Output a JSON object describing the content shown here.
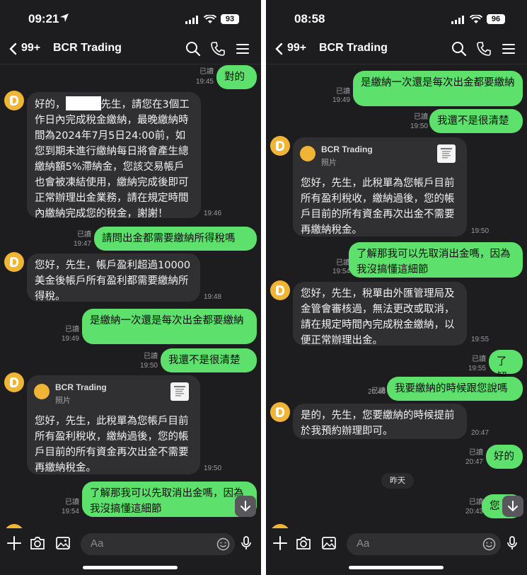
{
  "screens": [
    {
      "status": {
        "time": "09:21",
        "battery": "93"
      },
      "nav": {
        "back_count": "99+",
        "title": "BCR Trading"
      },
      "messages": {
        "m1": {
          "text": "對的",
          "read": "已讀",
          "time": "19:45"
        },
        "m2": {
          "pre": "好的，",
          "post": "先生，請您在3個工作日內完成稅金繳納，最晚繳納時間為2024年7月5日24:00前，如您到期未進行繳納每日將會產生總繳納額5%滯納金，您該交易帳戶也會被凍結使用，繳納完成後即可正常辦理出金業務，請在規定時間內繳納完成您的稅金，謝謝！",
          "time": "19:46"
        },
        "m3": {
          "text": "請問出金都需要繳納所得稅嗎",
          "read": "已讀",
          "time": "19:47"
        },
        "m4": {
          "text": "您好，先生，帳戶盈利超過10000美金後帳戶所有盈利都需要繳納所得稅。",
          "time": "19:48"
        },
        "m5": {
          "text": "是繳納一次還是每次出金都要繳納",
          "read": "已讀",
          "time": "19:49"
        },
        "m6": {
          "text": "我還不是很清楚",
          "read": "已讀",
          "time": "19:50"
        },
        "m7": {
          "sender": "BCR Trading",
          "sub": "照片",
          "text": "您好，先生，此稅單為您帳戶目前所有盈利稅收，繳納過後，您的帳戶目前的所有資金再次出金不需要再繳納稅金。",
          "time": "19:50"
        },
        "m8": {
          "text": "了解那我可以先取消出金嗎，因為我沒搞懂這細節",
          "read": "已讀",
          "time": "19:54"
        }
      },
      "input": {
        "placeholder": "Aa"
      }
    },
    {
      "status": {
        "time": "08:58",
        "battery": "96"
      },
      "nav": {
        "back_count": "99+",
        "title": "BCR Trading"
      },
      "messages": {
        "m1": {
          "text": "是繳納一次還是每次出金都要繳納",
          "read": "已讀",
          "time": "19:49"
        },
        "m2": {
          "text": "我還不是很清楚",
          "read": "已讀",
          "time": "19:50"
        },
        "m3": {
          "sender": "BCR Trading",
          "sub": "照片",
          "text": "您好，先生，此稅單為您帳戶目前所有盈利稅收，繳納過後，您的帳戶目前的所有資金再次出金不需要再繳納稅金。",
          "time": "19:50"
        },
        "m4": {
          "text": "了解那我可以先取消出金嗎，因為我沒搞懂這細節",
          "read": "已讀",
          "time": "19:54"
        },
        "m5": {
          "text": "您好，先生，稅單由外匯管理局及金管會審核過，無法更改或取消，請在規定時間內完成稅金繳納，以便正常辦理出金。",
          "time": "19:55"
        },
        "m6": {
          "text": "了解",
          "read": "已讀",
          "time": "19:55"
        },
        "m7": {
          "text": "我要繳納的時候跟您說嗎",
          "read": "已讀",
          "time": "20:46"
        },
        "m8": {
          "text": "是的，先生，您要繳納的時候提前於我預約辦理即可。",
          "time": "20:47"
        },
        "m9": {
          "text": "好的",
          "read": "已讀",
          "time": "20:47"
        },
        "date_divider": "昨天",
        "m10": {
          "text": "您",
          "read": "已讀",
          "time": "20:43"
        }
      },
      "input": {
        "placeholder": "Aa"
      }
    }
  ],
  "colors": {
    "outgoing": "#5ee06c",
    "incoming": "#303033",
    "background": "#1d1d1f",
    "avatar": "#f0b536"
  }
}
